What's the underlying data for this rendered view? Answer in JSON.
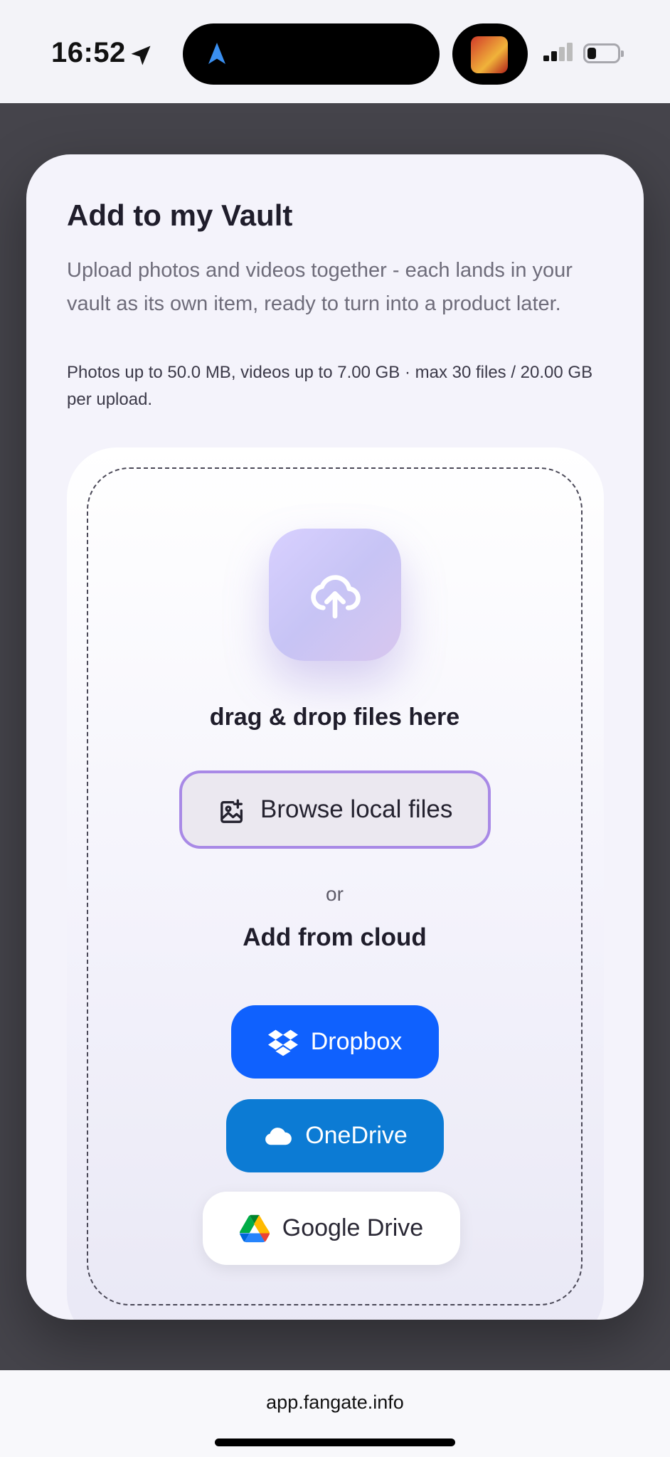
{
  "status_bar": {
    "time": "16:52"
  },
  "modal": {
    "title": "Add to my Vault",
    "description": "Upload photos and videos together - each lands in your vault as its own item, ready to turn into a product later.",
    "limits": "Photos up to 50.0 MB, videos up to 7.00 GB · max 30 files / 20.00 GB per upload.",
    "dropzone": {
      "prompt": "drag & drop files here",
      "browse_label": "Browse local files",
      "or_label": "or",
      "cloud_title": "Add from cloud",
      "cloud_buttons": [
        {
          "label": "Dropbox",
          "icon": "dropbox-icon",
          "color": "#0F61FE"
        },
        {
          "label": "OneDrive",
          "icon": "cloud-icon",
          "color": "#0C7BD4"
        },
        {
          "label": "Google Drive",
          "icon": "google-drive-icon",
          "color": "#FFFFFF"
        }
      ]
    }
  },
  "browser": {
    "url": "app.fangate.info"
  },
  "colors": {
    "accent": "#A889E6",
    "dropbox": "#0F61FE",
    "onedrive": "#0C7BD4"
  }
}
